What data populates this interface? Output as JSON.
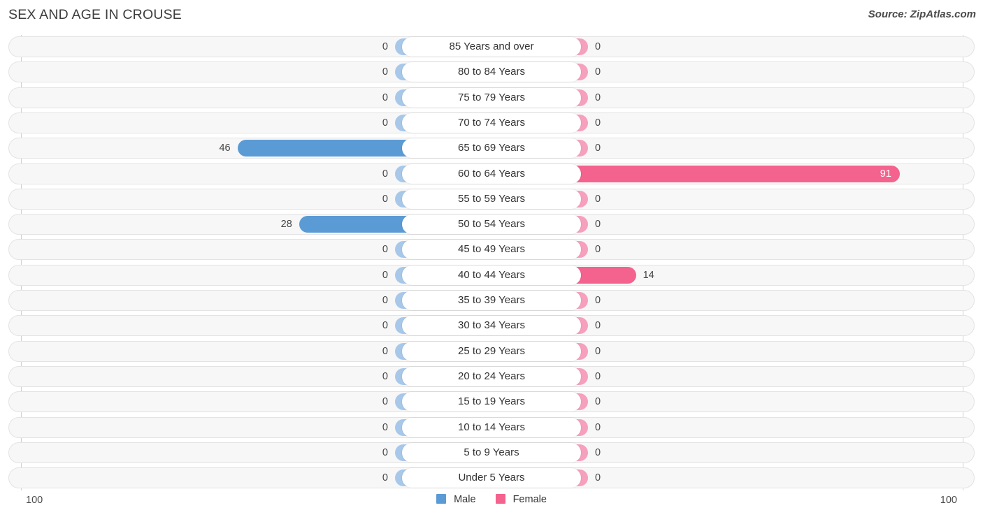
{
  "header": {
    "title": "SEX AND AGE IN CROUSE",
    "source": "Source: ZipAtlas.com"
  },
  "legend": {
    "male_label": "Male",
    "female_label": "Female",
    "male_color": "#5b9bd5",
    "female_color": "#f4628e"
  },
  "axis": {
    "left_tick": "100",
    "right_tick": "100"
  },
  "palette": {
    "male_light": "#a8c8ea",
    "male_strong": "#5b9bd5",
    "female_light": "#f6a0bd",
    "female_strong": "#f4628e",
    "row_bg": "#f7f7f7",
    "row_border": "#e3e3e3"
  },
  "chart_data": {
    "type": "bar",
    "title": "SEX AND AGE IN CROUSE",
    "subtitle": "Source: ZipAtlas.com",
    "orientation": "horizontal",
    "style": "population-pyramid",
    "xlabel": "",
    "ylabel": "",
    "xlim": [
      -100,
      100
    ],
    "axis_tick_labels": [
      "100",
      "100"
    ],
    "grid": false,
    "legend_position": "bottom-center",
    "categories": [
      "85 Years and over",
      "80 to 84 Years",
      "75 to 79 Years",
      "70 to 74 Years",
      "65 to 69 Years",
      "60 to 64 Years",
      "55 to 59 Years",
      "50 to 54 Years",
      "45 to 49 Years",
      "40 to 44 Years",
      "35 to 39 Years",
      "30 to 34 Years",
      "25 to 29 Years",
      "20 to 24 Years",
      "15 to 19 Years",
      "10 to 14 Years",
      "5 to 9 Years",
      "Under 5 Years"
    ],
    "series": [
      {
        "name": "Male",
        "color": "#5b9bd5",
        "values": [
          0,
          0,
          0,
          0,
          46,
          0,
          0,
          28,
          0,
          0,
          0,
          0,
          0,
          0,
          0,
          0,
          0,
          0
        ]
      },
      {
        "name": "Female",
        "color": "#f4628e",
        "values": [
          0,
          0,
          0,
          0,
          0,
          91,
          0,
          0,
          0,
          14,
          0,
          0,
          0,
          0,
          0,
          0,
          0,
          0
        ]
      }
    ]
  },
  "rows": [
    {
      "category": "85 Years and over",
      "male": "0",
      "female": "0"
    },
    {
      "category": "80 to 84 Years",
      "male": "0",
      "female": "0"
    },
    {
      "category": "75 to 79 Years",
      "male": "0",
      "female": "0"
    },
    {
      "category": "70 to 74 Years",
      "male": "0",
      "female": "0"
    },
    {
      "category": "65 to 69 Years",
      "male": "46",
      "female": "0"
    },
    {
      "category": "60 to 64 Years",
      "male": "0",
      "female": "91"
    },
    {
      "category": "55 to 59 Years",
      "male": "0",
      "female": "0"
    },
    {
      "category": "50 to 54 Years",
      "male": "28",
      "female": "0"
    },
    {
      "category": "45 to 49 Years",
      "male": "0",
      "female": "0"
    },
    {
      "category": "40 to 44 Years",
      "male": "0",
      "female": "14"
    },
    {
      "category": "35 to 39 Years",
      "male": "0",
      "female": "0"
    },
    {
      "category": "30 to 34 Years",
      "male": "0",
      "female": "0"
    },
    {
      "category": "25 to 29 Years",
      "male": "0",
      "female": "0"
    },
    {
      "category": "20 to 24 Years",
      "male": "0",
      "female": "0"
    },
    {
      "category": "15 to 19 Years",
      "male": "0",
      "female": "0"
    },
    {
      "category": "10 to 14 Years",
      "male": "0",
      "female": "0"
    },
    {
      "category": "5 to 9 Years",
      "male": "0",
      "female": "0"
    },
    {
      "category": "Under 5 Years",
      "male": "0",
      "female": "0"
    }
  ]
}
